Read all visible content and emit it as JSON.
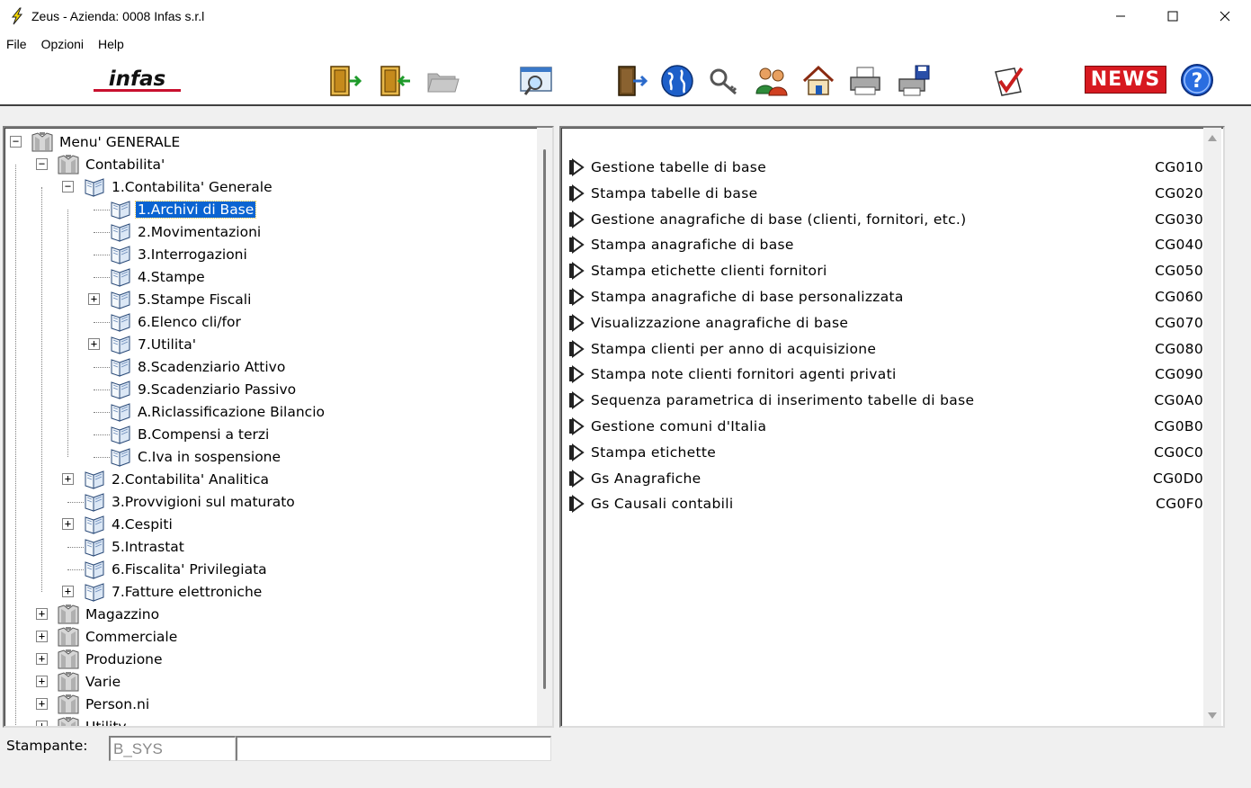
{
  "window": {
    "title": "Zeus - Azienda: 0008 Infas s.r.l",
    "minimize_glyph": "—",
    "maximize_glyph": "☐",
    "close_glyph": "✕"
  },
  "menubar": {
    "items": [
      "File",
      "Opzioni",
      "Help"
    ]
  },
  "toolbar": {
    "logo_text": "infas",
    "news_label": "NEWS",
    "help_glyph": "?",
    "icons": [
      "enter-door-icon",
      "move-door-icon",
      "folder-icon",
      "search-window-icon",
      "exit-door-icon",
      "globe-icon",
      "key-icon",
      "users-icon",
      "home-icon",
      "printer-icon",
      "print-save-icon",
      "checklist-icon",
      "news-icon",
      "help-icon"
    ]
  },
  "tree": {
    "nodes": [
      {
        "label": "Menu' GENERALE",
        "expander": "−"
      },
      {
        "label": "Contabilita'",
        "expander": "−"
      },
      {
        "label": "1.Contabilita' Generale",
        "expander": "−"
      },
      {
        "label": "1.Archivi di Base",
        "selected": true
      },
      {
        "label": "2.Movimentazioni"
      },
      {
        "label": "3.Interrogazioni"
      },
      {
        "label": "4.Stampe"
      },
      {
        "label": "5.Stampe Fiscali",
        "expander": "+"
      },
      {
        "label": "6.Elenco cli/for"
      },
      {
        "label": "7.Utilita'",
        "expander": "+"
      },
      {
        "label": "8.Scadenziario Attivo"
      },
      {
        "label": "9.Scadenziario Passivo"
      },
      {
        "label": "A.Riclassificazione  Bilancio"
      },
      {
        "label": "B.Compensi a terzi"
      },
      {
        "label": "C.Iva in sospensione"
      },
      {
        "label": "2.Contabilita' Analitica",
        "expander": "+"
      },
      {
        "label": "3.Provvigioni sul maturato"
      },
      {
        "label": "4.Cespiti",
        "expander": "+"
      },
      {
        "label": "5.Intrastat"
      },
      {
        "label": "6.Fiscalita' Privilegiata"
      },
      {
        "label": "7.Fatture elettroniche",
        "expander": "+"
      },
      {
        "label": "Magazzino",
        "expander": "+"
      },
      {
        "label": "Commerciale",
        "expander": "+"
      },
      {
        "label": "Produzione",
        "expander": "+"
      },
      {
        "label": "Varie",
        "expander": "+"
      },
      {
        "label": "Person.ni",
        "expander": "+"
      },
      {
        "label": "Utility",
        "expander": "+"
      }
    ]
  },
  "functions": {
    "items": [
      {
        "label": "Gestione tabelle di base",
        "code": "CG010"
      },
      {
        "label": "Stampa tabelle di base",
        "code": "CG020"
      },
      {
        "label": "Gestione anagrafiche di base (clienti, fornitori, etc.)",
        "code": "CG030"
      },
      {
        "label": "Stampa anagrafiche di base",
        "code": "CG040"
      },
      {
        "label": "Stampa etichette clienti fornitori",
        "code": "CG050"
      },
      {
        "label": "Stampa anagrafiche di base personalizzata",
        "code": "CG060"
      },
      {
        "label": "Visualizzazione anagrafiche di base",
        "code": "CG070"
      },
      {
        "label": "Stampa clienti per anno di acquisizione",
        "code": "CG080"
      },
      {
        "label": "Stampa note clienti fornitori agenti privati",
        "code": "CG090"
      },
      {
        "label": "Sequenza parametrica di inserimento tabelle di base",
        "code": "CG0A0"
      },
      {
        "label": "Gestione comuni d'Italia",
        "code": "CG0B0"
      },
      {
        "label": "Stampa etichette",
        "code": "CG0C0"
      },
      {
        "label": "Gs Anagrafiche",
        "code": "CG0D0"
      },
      {
        "label": "Gs Causali contabili",
        "code": "CG0F0"
      }
    ]
  },
  "status": {
    "printer_label": "Stampante:",
    "printer_value": "B_SYS",
    "printer_description": ""
  },
  "colors": {
    "selection": "#0a64d2",
    "news_red": "#d71920",
    "logo_red": "#c8102e"
  }
}
